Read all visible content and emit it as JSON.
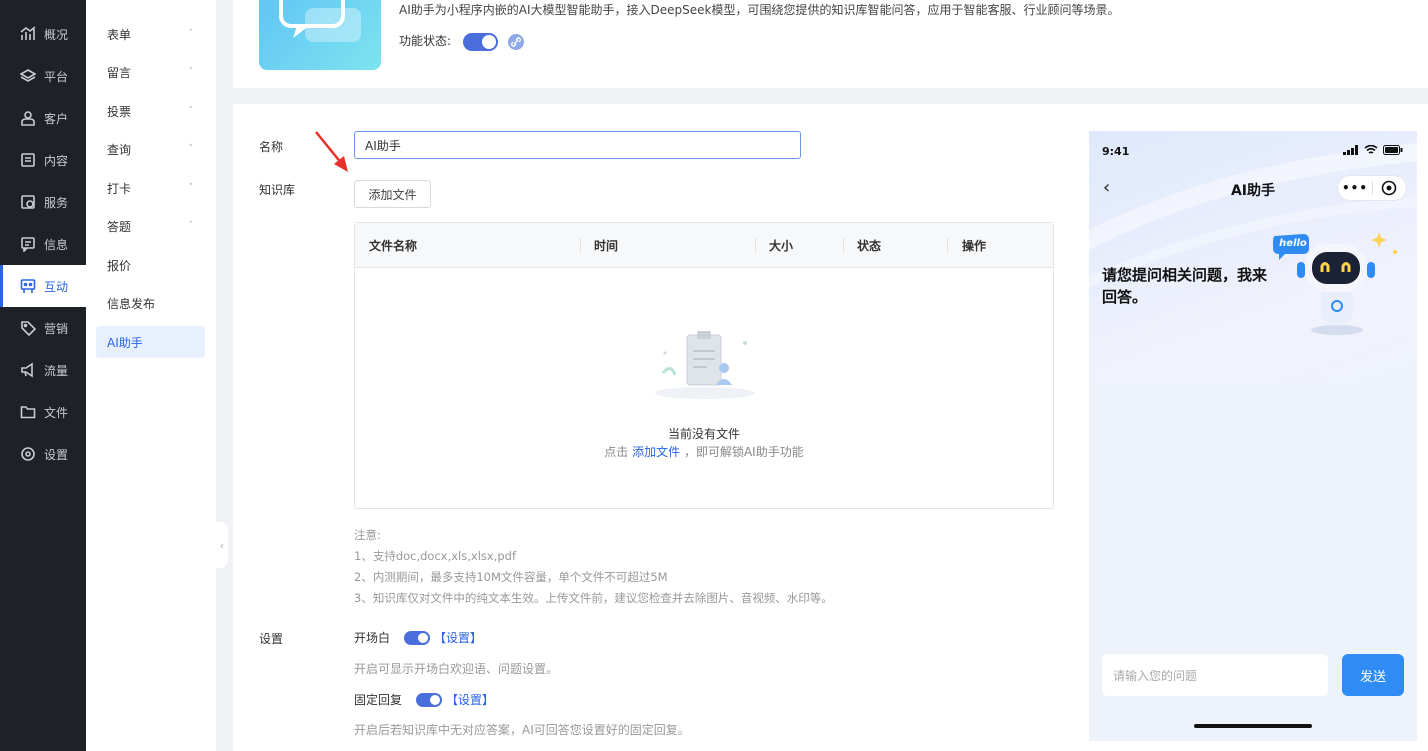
{
  "nav": {
    "items": [
      {
        "label": "概况",
        "icon": "chart-icon"
      },
      {
        "label": "平台",
        "icon": "layers-icon"
      },
      {
        "label": "客户",
        "icon": "user-icon"
      },
      {
        "label": "内容",
        "icon": "document-icon"
      },
      {
        "label": "服务",
        "icon": "service-icon"
      },
      {
        "label": "信息",
        "icon": "message-icon"
      },
      {
        "label": "互动",
        "icon": "interact-icon",
        "active": true
      },
      {
        "label": "营销",
        "icon": "tag-icon"
      },
      {
        "label": "流量",
        "icon": "megaphone-icon"
      },
      {
        "label": "文件",
        "icon": "folder-icon"
      },
      {
        "label": "设置",
        "icon": "gear-icon"
      }
    ]
  },
  "subnav": {
    "items": [
      {
        "label": "表单",
        "chevron": "˅"
      },
      {
        "label": "留言",
        "chevron": "˅"
      },
      {
        "label": "投票",
        "chevron": "˅"
      },
      {
        "label": "查询",
        "chevron": "˅"
      },
      {
        "label": "打卡",
        "chevron": "˅"
      },
      {
        "label": "答题",
        "chevron": "˅"
      },
      {
        "label": "报价"
      },
      {
        "label": "信息发布"
      },
      {
        "label": "AI助手",
        "active": true
      }
    ]
  },
  "header": {
    "description": "AI助手为小程序内嵌的AI大模型智能助手，接入DeepSeek模型，可围绕您提供的知识库智能问答，应用于智能客服、行业顾问等场景。",
    "status_label": "功能状态:",
    "status_on": true
  },
  "form": {
    "name_label": "名称",
    "name_value": "AI助手",
    "kb_label": "知识库",
    "add_file_label": "添加文件",
    "table": {
      "columns": [
        "文件名称",
        "时间",
        "大小",
        "状态",
        "操作"
      ],
      "rows": [],
      "empty_title": "当前没有文件",
      "empty_prefix": "点击",
      "empty_link": "添加文件",
      "empty_suffix": "，即可解锁AI助手功能"
    },
    "notes": [
      "注意:",
      "1、支持doc,docx,xls,xlsx,pdf",
      "2、内测期间，最多支持10M文件容量，单个文件不可超过5M",
      "3、知识库仅对文件中的纯文本生效。上传文件前，建议您检查并去除图片、音视频、水印等。"
    ],
    "settings_label": "设置",
    "settings": [
      {
        "label": "开场白",
        "link": "【设置】",
        "on": true,
        "desc": "开启可显示开场白欢迎语、问题设置。"
      },
      {
        "label": "固定回复",
        "link": "【设置】",
        "on": true,
        "desc": "开启后若知识库中无对应答案，AI可回答您设置好的固定回复。"
      }
    ]
  },
  "preview": {
    "time": "9:41",
    "title": "AI助手",
    "greeting": "请您提问相关问题，我来回答。",
    "bubble": "hello",
    "input_placeholder": "请输入您的问题",
    "send_label": "发送",
    "capsule_dots": "•••"
  },
  "colors": {
    "accent": "#2b63e6",
    "nav_bg": "#1e2126",
    "send": "#2f8cf5"
  }
}
